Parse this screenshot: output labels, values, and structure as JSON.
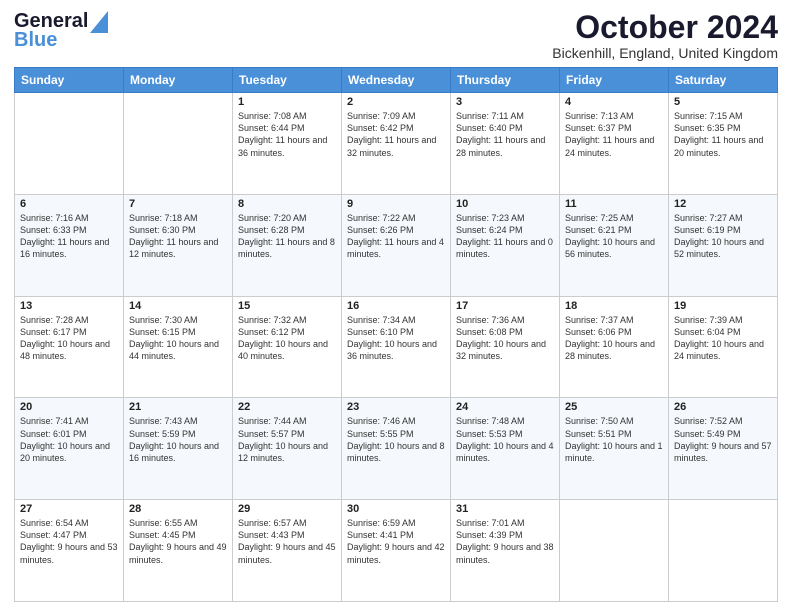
{
  "header": {
    "logo_line1": "General",
    "logo_line2": "Blue",
    "month_title": "October 2024",
    "location": "Bickenhill, England, United Kingdom"
  },
  "days_of_week": [
    "Sunday",
    "Monday",
    "Tuesday",
    "Wednesday",
    "Thursday",
    "Friday",
    "Saturday"
  ],
  "weeks": [
    [
      {
        "day": "",
        "sunrise": "",
        "sunset": "",
        "daylight": ""
      },
      {
        "day": "",
        "sunrise": "",
        "sunset": "",
        "daylight": ""
      },
      {
        "day": "1",
        "sunrise": "Sunrise: 7:08 AM",
        "sunset": "Sunset: 6:44 PM",
        "daylight": "Daylight: 11 hours and 36 minutes."
      },
      {
        "day": "2",
        "sunrise": "Sunrise: 7:09 AM",
        "sunset": "Sunset: 6:42 PM",
        "daylight": "Daylight: 11 hours and 32 minutes."
      },
      {
        "day": "3",
        "sunrise": "Sunrise: 7:11 AM",
        "sunset": "Sunset: 6:40 PM",
        "daylight": "Daylight: 11 hours and 28 minutes."
      },
      {
        "day": "4",
        "sunrise": "Sunrise: 7:13 AM",
        "sunset": "Sunset: 6:37 PM",
        "daylight": "Daylight: 11 hours and 24 minutes."
      },
      {
        "day": "5",
        "sunrise": "Sunrise: 7:15 AM",
        "sunset": "Sunset: 6:35 PM",
        "daylight": "Daylight: 11 hours and 20 minutes."
      }
    ],
    [
      {
        "day": "6",
        "sunrise": "Sunrise: 7:16 AM",
        "sunset": "Sunset: 6:33 PM",
        "daylight": "Daylight: 11 hours and 16 minutes."
      },
      {
        "day": "7",
        "sunrise": "Sunrise: 7:18 AM",
        "sunset": "Sunset: 6:30 PM",
        "daylight": "Daylight: 11 hours and 12 minutes."
      },
      {
        "day": "8",
        "sunrise": "Sunrise: 7:20 AM",
        "sunset": "Sunset: 6:28 PM",
        "daylight": "Daylight: 11 hours and 8 minutes."
      },
      {
        "day": "9",
        "sunrise": "Sunrise: 7:22 AM",
        "sunset": "Sunset: 6:26 PM",
        "daylight": "Daylight: 11 hours and 4 minutes."
      },
      {
        "day": "10",
        "sunrise": "Sunrise: 7:23 AM",
        "sunset": "Sunset: 6:24 PM",
        "daylight": "Daylight: 11 hours and 0 minutes."
      },
      {
        "day": "11",
        "sunrise": "Sunrise: 7:25 AM",
        "sunset": "Sunset: 6:21 PM",
        "daylight": "Daylight: 10 hours and 56 minutes."
      },
      {
        "day": "12",
        "sunrise": "Sunrise: 7:27 AM",
        "sunset": "Sunset: 6:19 PM",
        "daylight": "Daylight: 10 hours and 52 minutes."
      }
    ],
    [
      {
        "day": "13",
        "sunrise": "Sunrise: 7:28 AM",
        "sunset": "Sunset: 6:17 PM",
        "daylight": "Daylight: 10 hours and 48 minutes."
      },
      {
        "day": "14",
        "sunrise": "Sunrise: 7:30 AM",
        "sunset": "Sunset: 6:15 PM",
        "daylight": "Daylight: 10 hours and 44 minutes."
      },
      {
        "day": "15",
        "sunrise": "Sunrise: 7:32 AM",
        "sunset": "Sunset: 6:12 PM",
        "daylight": "Daylight: 10 hours and 40 minutes."
      },
      {
        "day": "16",
        "sunrise": "Sunrise: 7:34 AM",
        "sunset": "Sunset: 6:10 PM",
        "daylight": "Daylight: 10 hours and 36 minutes."
      },
      {
        "day": "17",
        "sunrise": "Sunrise: 7:36 AM",
        "sunset": "Sunset: 6:08 PM",
        "daylight": "Daylight: 10 hours and 32 minutes."
      },
      {
        "day": "18",
        "sunrise": "Sunrise: 7:37 AM",
        "sunset": "Sunset: 6:06 PM",
        "daylight": "Daylight: 10 hours and 28 minutes."
      },
      {
        "day": "19",
        "sunrise": "Sunrise: 7:39 AM",
        "sunset": "Sunset: 6:04 PM",
        "daylight": "Daylight: 10 hours and 24 minutes."
      }
    ],
    [
      {
        "day": "20",
        "sunrise": "Sunrise: 7:41 AM",
        "sunset": "Sunset: 6:01 PM",
        "daylight": "Daylight: 10 hours and 20 minutes."
      },
      {
        "day": "21",
        "sunrise": "Sunrise: 7:43 AM",
        "sunset": "Sunset: 5:59 PM",
        "daylight": "Daylight: 10 hours and 16 minutes."
      },
      {
        "day": "22",
        "sunrise": "Sunrise: 7:44 AM",
        "sunset": "Sunset: 5:57 PM",
        "daylight": "Daylight: 10 hours and 12 minutes."
      },
      {
        "day": "23",
        "sunrise": "Sunrise: 7:46 AM",
        "sunset": "Sunset: 5:55 PM",
        "daylight": "Daylight: 10 hours and 8 minutes."
      },
      {
        "day": "24",
        "sunrise": "Sunrise: 7:48 AM",
        "sunset": "Sunset: 5:53 PM",
        "daylight": "Daylight: 10 hours and 4 minutes."
      },
      {
        "day": "25",
        "sunrise": "Sunrise: 7:50 AM",
        "sunset": "Sunset: 5:51 PM",
        "daylight": "Daylight: 10 hours and 1 minute."
      },
      {
        "day": "26",
        "sunrise": "Sunrise: 7:52 AM",
        "sunset": "Sunset: 5:49 PM",
        "daylight": "Daylight: 9 hours and 57 minutes."
      }
    ],
    [
      {
        "day": "27",
        "sunrise": "Sunrise: 6:54 AM",
        "sunset": "Sunset: 4:47 PM",
        "daylight": "Daylight: 9 hours and 53 minutes."
      },
      {
        "day": "28",
        "sunrise": "Sunrise: 6:55 AM",
        "sunset": "Sunset: 4:45 PM",
        "daylight": "Daylight: 9 hours and 49 minutes."
      },
      {
        "day": "29",
        "sunrise": "Sunrise: 6:57 AM",
        "sunset": "Sunset: 4:43 PM",
        "daylight": "Daylight: 9 hours and 45 minutes."
      },
      {
        "day": "30",
        "sunrise": "Sunrise: 6:59 AM",
        "sunset": "Sunset: 4:41 PM",
        "daylight": "Daylight: 9 hours and 42 minutes."
      },
      {
        "day": "31",
        "sunrise": "Sunrise: 7:01 AM",
        "sunset": "Sunset: 4:39 PM",
        "daylight": "Daylight: 9 hours and 38 minutes."
      },
      {
        "day": "",
        "sunrise": "",
        "sunset": "",
        "daylight": ""
      },
      {
        "day": "",
        "sunrise": "",
        "sunset": "",
        "daylight": ""
      }
    ]
  ]
}
